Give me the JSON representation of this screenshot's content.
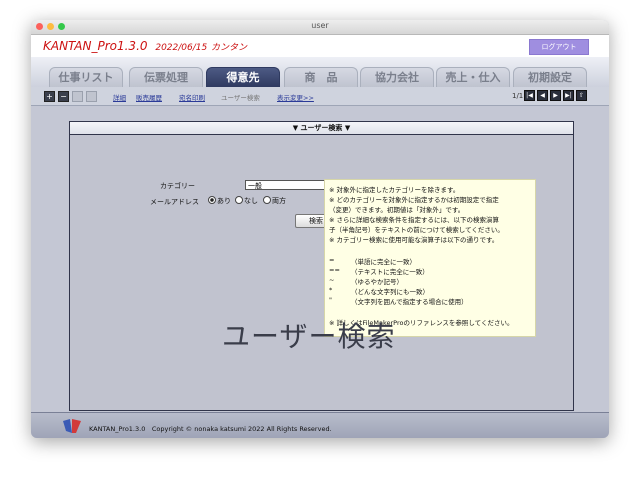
{
  "window": {
    "title": "user"
  },
  "header": {
    "app_name": "KANTAN_Pro1.3.0",
    "date": "2022/06/15",
    "user": "カンタン",
    "logout": "ログアウト"
  },
  "tabs": [
    "仕事リスト",
    "伝票処理",
    "得意先",
    "商　品",
    "協力会社",
    "売上・仕入",
    "初期設定"
  ],
  "active_tab": "得意先",
  "toolbar": {
    "links": [
      "詳細",
      "販売履歴",
      "宛名印刷",
      "ユーザー検索",
      "表示変更>>"
    ],
    "current_link": "ユーザー検索",
    "pager": "1/1"
  },
  "panel": {
    "title": "▼ ユーザー検索 ▼",
    "category_label": "カテゴリー",
    "category_value": "一般",
    "mail_label": "メールアドレス",
    "mail_options": [
      "あり",
      "なし",
      "両方"
    ],
    "mail_selected": "あり",
    "search_button": "検索",
    "watermark": "ユーザー検索"
  },
  "note": {
    "lines": [
      "※ 対象外に指定したカテゴリーを除きます。",
      "※ どのカテゴリーを対象外に指定するかは初期設定で指定",
      "（変更）できます。初期値は「対象外」です。",
      "※ さらに詳細な検索条件を指定するには、以下の検索演算",
      "子（半角記号）をテキストの前につけて検索してください。",
      "※ カテゴリー検索に使用可能な演算子は以下の通りです。"
    ],
    "operators": [
      {
        "op": "=",
        "desc": "（単語に完全に一致）"
      },
      {
        "op": "==",
        "desc": "（テキストに完全に一致）"
      },
      {
        "op": "~",
        "desc": "（ゆるやか記号）"
      },
      {
        "op": "*",
        "desc": "（どんな文字列にも一致）"
      },
      {
        "op": "\"",
        "desc": "（文字列を囲んで指定する場合に使用）"
      }
    ],
    "footer_line": "※ 詳しくはFileMakerProのリファレンスを参照してください。"
  },
  "footer": {
    "text": "KANTAN_Pro1.3.0　Copyright © nonaka katsumi 2022 All Rights Reserved."
  },
  "colors": {
    "accent": "#2f3a60",
    "title_red": "#cc1111",
    "logout": "#9f8ee0",
    "note_bg": "#ffffe5"
  }
}
